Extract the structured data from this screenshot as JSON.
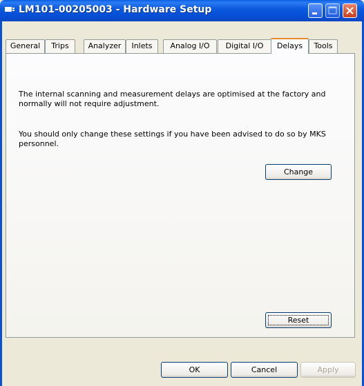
{
  "window": {
    "title": "LM101-00205003 - Hardware Setup"
  },
  "tabs": [
    {
      "label": "General",
      "active": false
    },
    {
      "label": "Trips",
      "active": false
    },
    {
      "label": "Analyzer",
      "active": false
    },
    {
      "label": "Inlets",
      "active": false
    },
    {
      "label": "Analog I/O",
      "active": false
    },
    {
      "label": "Digital I/O",
      "active": false
    },
    {
      "label": "Delays",
      "active": true
    },
    {
      "label": "Tools",
      "active": false
    }
  ],
  "delays": {
    "paragraph1": "The internal scanning and measurement delays are optimised at the factory and normally will not require adjustment.",
    "paragraph2": "You should only change these settings if you have been advised to do so by MKS personnel.",
    "change_label": "Change",
    "reset_label": "Reset"
  },
  "footer": {
    "ok_label": "OK",
    "cancel_label": "Cancel",
    "apply_label": "Apply",
    "apply_enabled": false
  },
  "colors": {
    "titlebar": "#0550d8",
    "face": "#ece9d8",
    "active_tab_accent": "#e68b2c",
    "close_button": "#c63f1f"
  }
}
